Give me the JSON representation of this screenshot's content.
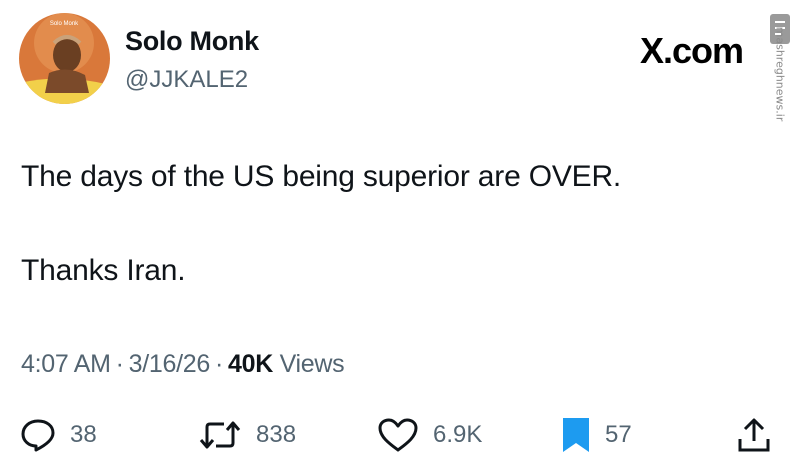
{
  "user": {
    "display_name": "Solo Monk",
    "handle": "@JJKALE2",
    "avatar_text": "Solo Monk"
  },
  "brand": "X.com",
  "watermark": "mashreghnews.ir",
  "tweet": {
    "lines": [
      "The days of the US being superior are OVER.",
      "Thanks Iran."
    ]
  },
  "meta": {
    "time": "4:07 AM",
    "date": "3/16/26",
    "views_count": "40K",
    "views_label": "Views"
  },
  "actions": {
    "replies": "38",
    "reposts": "838",
    "likes": "6.9K",
    "bookmarks": "57"
  },
  "colors": {
    "text": "#0f1419",
    "secondary": "#536471",
    "accent": "#1d9bf0"
  },
  "icons": [
    "reply-icon",
    "repost-icon",
    "like-icon",
    "bookmark-icon",
    "share-icon"
  ]
}
